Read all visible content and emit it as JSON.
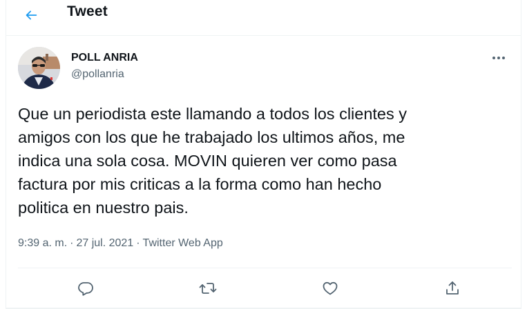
{
  "header": {
    "title": "Tweet",
    "back_icon": "arrow-left-icon"
  },
  "author": {
    "name": "POLL ANRIA",
    "handle": "@pollanria"
  },
  "tweet": {
    "text": "Que un periodista este llamando a todos los clientes y\namigos con los que he trabajado los ultimos años, me\nindica una sola cosa. MOVIN quieren ver como pasa\nfactura por mis criticas a la forma como han hecho\npolitica en nuestro pais.",
    "time": "9:39 a. m.",
    "date": "27 jul. 2021",
    "separator": "·",
    "source": "Twitter Web App"
  },
  "actions": [
    {
      "icon": "reply-icon"
    },
    {
      "icon": "retweet-icon"
    },
    {
      "icon": "like-icon"
    },
    {
      "icon": "share-icon"
    }
  ],
  "colors": {
    "accent": "#1d9bf0",
    "text": "#0f1419",
    "secondary": "#536471",
    "border": "#eff3f4"
  }
}
